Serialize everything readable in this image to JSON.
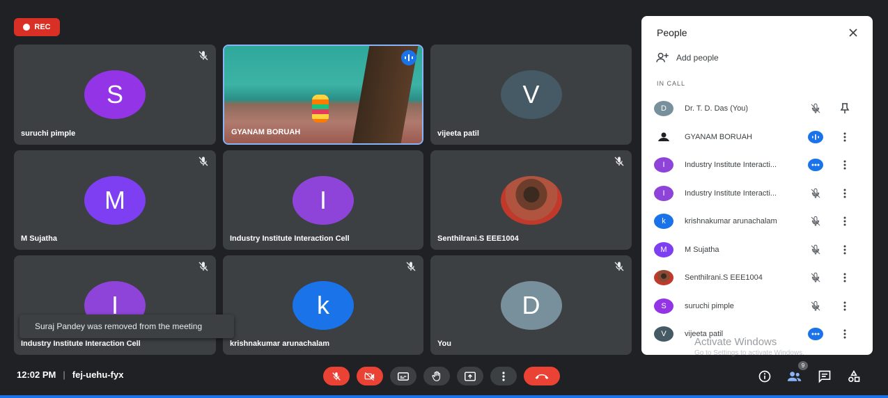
{
  "rec": {
    "label": "REC",
    "color": "#d93025"
  },
  "tiles": [
    {
      "name": "suruchi pimple",
      "initial": "S",
      "avatar_color": "#9334e6",
      "muted": true
    },
    {
      "name": "GYANAM BORUAH",
      "video": true,
      "speaking": true
    },
    {
      "name": "vijeeta patil",
      "initial": "V",
      "avatar_color": "#455a64",
      "muted": false
    },
    {
      "name": "M Sujatha",
      "initial": "M",
      "avatar_color": "#7e3ff2",
      "muted": true
    },
    {
      "name": "Industry Institute Interaction Cell",
      "initial": "I",
      "avatar_color": "#8e44d8",
      "muted": false
    },
    {
      "name": "Senthilrani.S EEE1004",
      "photo": true,
      "muted": true
    },
    {
      "name": "Industry Institute Interaction Cell",
      "initial": "I",
      "avatar_color": "#8e44d8",
      "muted": true
    },
    {
      "name": "krishnakumar arunachalam",
      "initial": "k",
      "avatar_color": "#1a73e8",
      "muted": true
    },
    {
      "name": "You",
      "initial": "D",
      "avatar_color": "#78909c",
      "muted": true
    }
  ],
  "toast": "Suraj Pandey was removed from the meeting",
  "panel": {
    "title": "People",
    "add_people": "Add people",
    "section": "IN CALL",
    "participants": [
      {
        "name": "Dr. T. D. Das (You)",
        "initial": "D",
        "avatar_color": "#78909c",
        "status": "muted",
        "action": "pin"
      },
      {
        "name": "GYANAM BORUAH",
        "avatar": "icon",
        "status": "speaking",
        "action": "more"
      },
      {
        "name": "Industry Institute Interacti...",
        "initial": "I",
        "avatar_color": "#8e44d8",
        "status": "dots",
        "action": "more"
      },
      {
        "name": "Industry Institute Interacti...",
        "initial": "I",
        "avatar_color": "#8e44d8",
        "status": "muted",
        "action": "more"
      },
      {
        "name": "krishnakumar arunachalam",
        "initial": "k",
        "avatar_color": "#1a73e8",
        "status": "muted",
        "action": "more"
      },
      {
        "name": "M Sujatha",
        "initial": "M",
        "avatar_color": "#7e3ff2",
        "status": "muted",
        "action": "more"
      },
      {
        "name": "Senthilrani.S EEE1004",
        "avatar": "photo",
        "status": "muted",
        "action": "more"
      },
      {
        "name": "suruchi pimple",
        "initial": "S",
        "avatar_color": "#9334e6",
        "status": "muted",
        "action": "more"
      },
      {
        "name": "vijeeta patil",
        "initial": "V",
        "avatar_color": "#455a64",
        "status": "dots",
        "action": "more"
      }
    ]
  },
  "watermark": {
    "line1": "Activate Windows",
    "line2": "Go to Settings to activate Windows."
  },
  "bottom": {
    "time": "12:02 PM",
    "separator": "|",
    "meeting_code": "fej-uehu-fyx",
    "participant_count": "9"
  },
  "colors": {
    "accent": "#1a73e8",
    "danger": "#ea4335",
    "tile": "#3c4043",
    "background": "#202124"
  }
}
